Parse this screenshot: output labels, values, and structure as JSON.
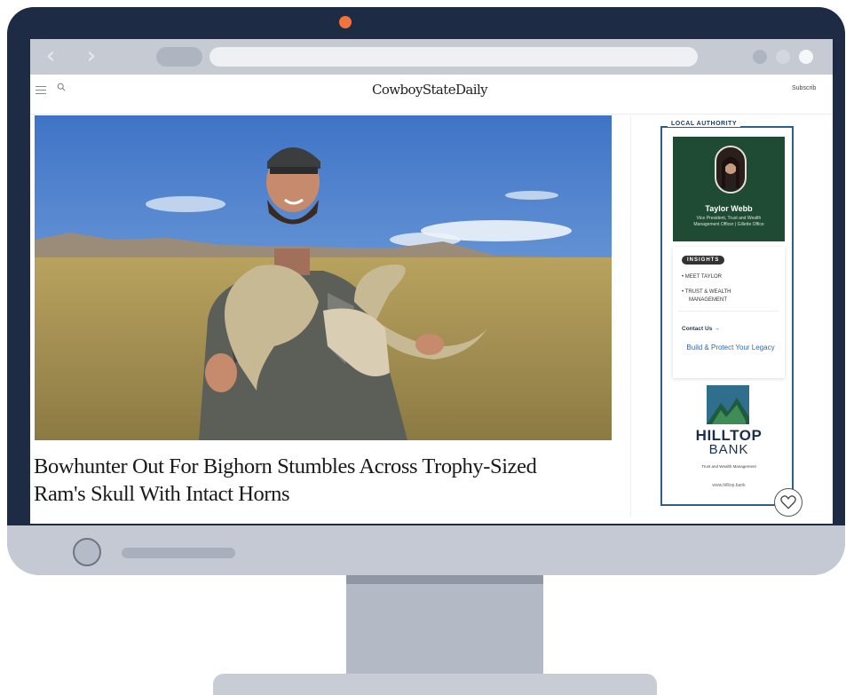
{
  "site": {
    "logo": "CowboyStateDaily",
    "subscribe_label": "Subscrib"
  },
  "article": {
    "headline_line1": "Bowhunter Out For Bighorn Stumbles Across Trophy-Sized",
    "headline_line2": "Ram's Skull With Intact Horns"
  },
  "ad": {
    "section_label": "LOCAL AUTHORITY",
    "person_name": "Taylor Webb",
    "person_title_line1": "Vice President, Trust and Wealth",
    "person_title_line2": "Management Officer | Gillette Office",
    "badge": "INSIGHTS",
    "bullets": [
      "MEET TAYLOR",
      "TRUST & WEALTH",
      "MANAGEMENT"
    ],
    "contact_label": "Contact Us →",
    "tagline": "Build & Protect Your Legacy",
    "brand_line1": "HILLTOP",
    "brand_line2": "BANK",
    "brand_sub": "Trust and Wealth Management",
    "url": "www.hilltop.bank"
  },
  "colors": {
    "bezel": "#1d2b45",
    "camera": "#f2733b",
    "ad_green": "#1f4b34",
    "ad_blue": "#2e5e8a"
  },
  "icons": {
    "menu": "menu-icon",
    "search": "search-icon",
    "back": "chevron-left-icon",
    "forward": "chevron-right-icon",
    "favorite": "heart-icon"
  }
}
